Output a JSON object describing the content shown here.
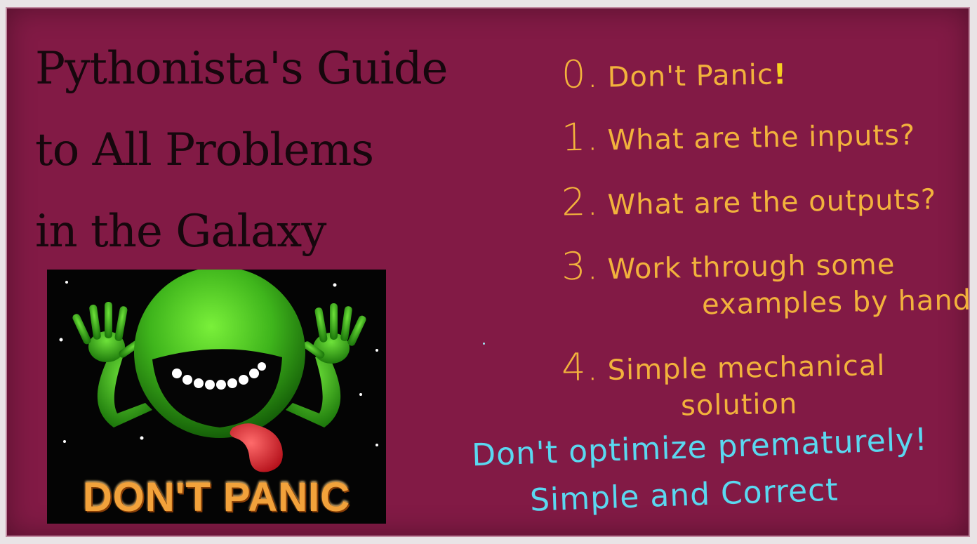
{
  "title": {
    "line1": "Pythonista's Guide",
    "line2": "to All Problems",
    "line3": "in the Galaxy"
  },
  "image": {
    "caption": "DON'T PANIC"
  },
  "steps": [
    {
      "number": "0.",
      "text": "Don't Panic",
      "bang": "!"
    },
    {
      "number": "1.",
      "text": "What are the inputs?"
    },
    {
      "number": "2.",
      "text": "What are the outputs?"
    },
    {
      "number": "3.",
      "text": "Work through some",
      "continuation": "examples by hand"
    },
    {
      "number": "4.",
      "text": "Simple mechanical",
      "continuation": "solution"
    }
  ],
  "advice": {
    "line1": "Don't optimize prematurely!",
    "line2": "Simple and Correct"
  },
  "colors": {
    "board": "#821a45",
    "steps": "#f2b23c",
    "advice": "#5ad8f0",
    "title": "#16070d"
  }
}
